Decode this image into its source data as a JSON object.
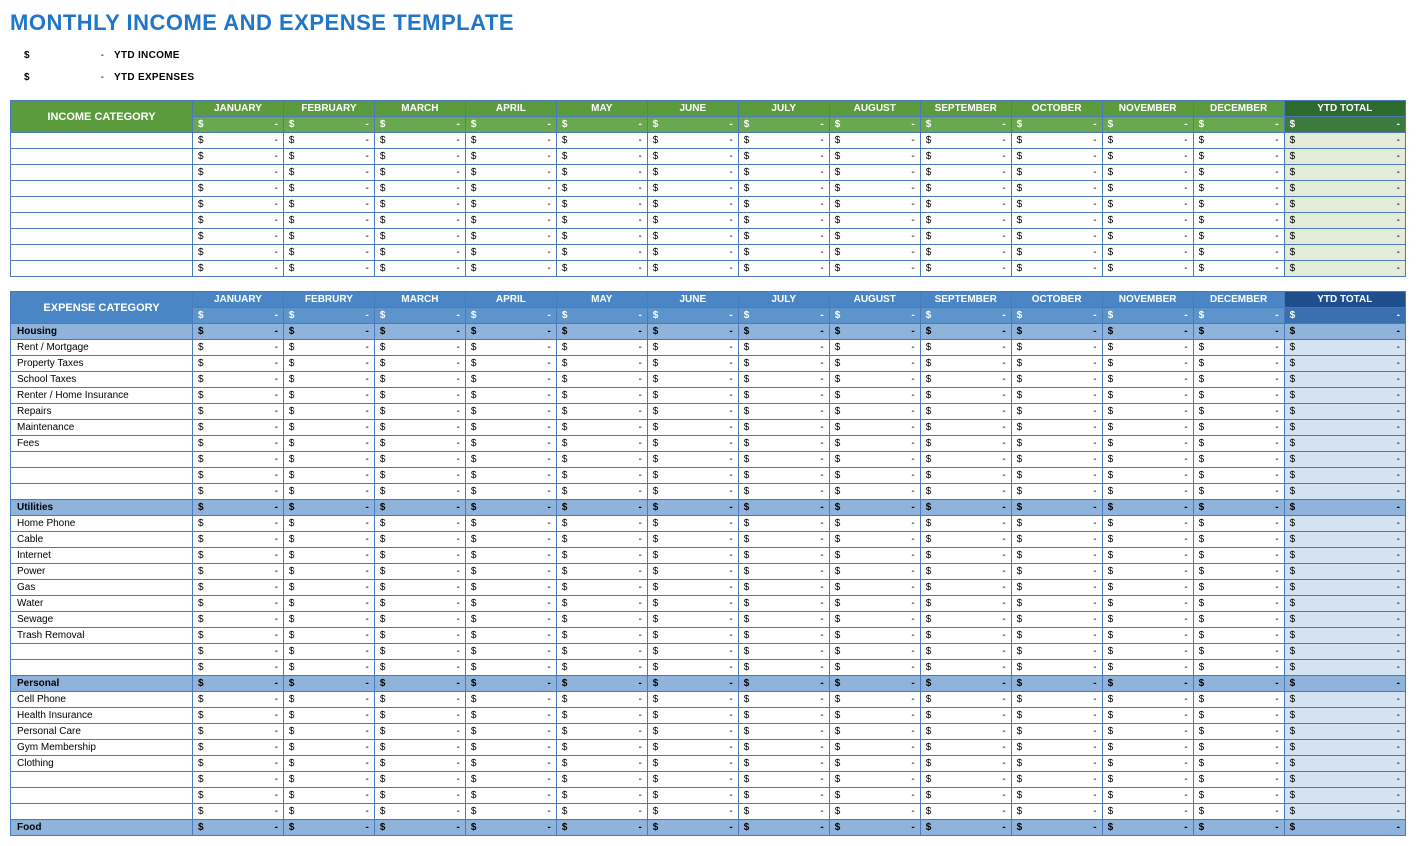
{
  "title": "MONTHLY INCOME AND EXPENSE TEMPLATE",
  "summary": [
    {
      "symbol": "$",
      "dash": "-",
      "label": "YTD INCOME"
    },
    {
      "symbol": "$",
      "dash": "-",
      "label": "YTD EXPENSES"
    }
  ],
  "months": [
    "JANUARY",
    "FEBRUARY",
    "MARCH",
    "APRIL",
    "MAY",
    "JUNE",
    "JULY",
    "AUGUST",
    "SEPTEMBER",
    "OCTOBER",
    "NOVEMBER",
    "DECEMBER"
  ],
  "expense_months": [
    "JANUARY",
    "FEBRURY",
    "MARCH",
    "APRIL",
    "MAY",
    "JUNE",
    "JULY",
    "AUGUST",
    "SEPTEMBER",
    "OCTOBER",
    "NOVEMBER",
    "DECEMBER"
  ],
  "ytd_label": "YTD TOTAL",
  "income_header": "INCOME CATEGORY",
  "expense_header": "EXPENSE CATEGORY",
  "currency": "$",
  "dash": "-",
  "income_rows": [
    "",
    "",
    "",
    "",
    "",
    "",
    "",
    "",
    ""
  ],
  "expense_sections": [
    {
      "name": "Housing",
      "rows": [
        "Rent / Mortgage",
        "Property Taxes",
        "School Taxes",
        "Renter / Home Insurance",
        "Repairs",
        "Maintenance",
        "Fees",
        "",
        "",
        ""
      ]
    },
    {
      "name": "Utilities",
      "rows": [
        "Home Phone",
        "Cable",
        "Internet",
        "Power",
        "Gas",
        "Water",
        "Sewage",
        "Trash Removal",
        "",
        ""
      ]
    },
    {
      "name": "Personal",
      "rows": [
        "Cell Phone",
        "Health Insurance",
        "Personal Care",
        "Gym Membership",
        "Clothing",
        "",
        "",
        ""
      ]
    },
    {
      "name": "Food",
      "rows": []
    }
  ]
}
